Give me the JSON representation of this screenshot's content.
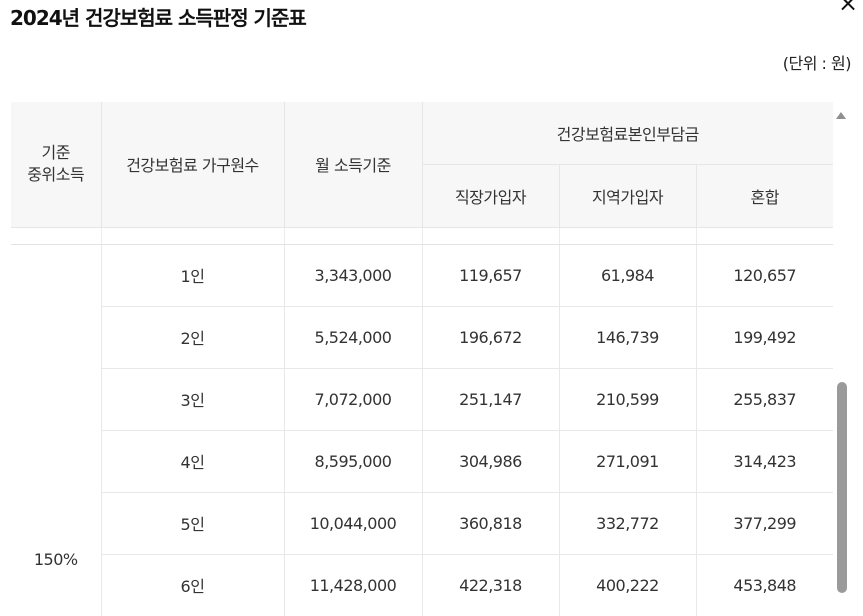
{
  "title": "2024년 건강보험료 소득판정 기준표",
  "close_symbol": "×",
  "unit": "(단위 : 원)",
  "header": {
    "col1": "기준\n중위소득",
    "col2": "건강보험료 가구원수",
    "col3": "월 소득기준",
    "group": "건강보험료본인부담금",
    "sub1": "직장가입자",
    "sub2": "지역가입자",
    "sub3": "혼합"
  },
  "level": "150%",
  "rows": [
    {
      "members": "1인",
      "income": "3,343,000",
      "employee": "119,657",
      "regional": "61,984",
      "mixed": "120,657"
    },
    {
      "members": "2인",
      "income": "5,524,000",
      "employee": "196,672",
      "regional": "146,739",
      "mixed": "199,492"
    },
    {
      "members": "3인",
      "income": "7,072,000",
      "employee": "251,147",
      "regional": "210,599",
      "mixed": "255,837"
    },
    {
      "members": "4인",
      "income": "8,595,000",
      "employee": "304,986",
      "regional": "271,091",
      "mixed": "314,423"
    },
    {
      "members": "5인",
      "income": "10,044,000",
      "employee": "360,818",
      "regional": "332,772",
      "mixed": "377,299"
    },
    {
      "members": "6인",
      "income": "11,428,000",
      "employee": "422,318",
      "regional": "400,222",
      "mixed": "453,848"
    }
  ]
}
